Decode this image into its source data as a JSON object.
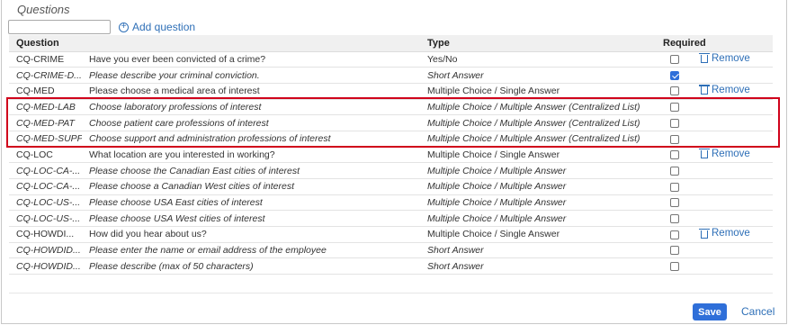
{
  "section_title": "Questions",
  "search": {
    "value": "",
    "placeholder": ""
  },
  "add_question_label": "Add question",
  "headers": {
    "question": "Question",
    "type": "Type",
    "required": "Required"
  },
  "rows": [
    {
      "code": "CQ-CRIME",
      "question": "Have you ever been convicted of a crime?",
      "type": "Yes/No",
      "required": false,
      "italic": false,
      "remove": "Remove"
    },
    {
      "code": "CQ-CRIME-D...",
      "question": "Please describe your criminal conviction.",
      "type": "Short Answer",
      "required": true,
      "italic": true,
      "remove": ""
    },
    {
      "code": "CQ-MED",
      "question": "Please choose a medical area of interest",
      "type": "Multiple Choice / Single Answer",
      "required": false,
      "italic": false,
      "remove": "Remove"
    },
    {
      "code": "CQ-MED-LAB",
      "question": "Choose laboratory professions of interest",
      "type": "Multiple Choice / Multiple Answer (Centralized List)",
      "required": false,
      "italic": true,
      "remove": ""
    },
    {
      "code": "CQ-MED-PAT",
      "question": "Choose patient care professions of interest",
      "type": "Multiple Choice / Multiple Answer (Centralized List)",
      "required": false,
      "italic": true,
      "remove": ""
    },
    {
      "code": "CQ-MED-SUPP",
      "question": "Choose support and administration professions of interest",
      "type": "Multiple Choice / Multiple Answer (Centralized List)",
      "required": false,
      "italic": true,
      "remove": ""
    },
    {
      "code": "CQ-LOC",
      "question": "What location are you interested in working?",
      "type": "Multiple Choice / Single Answer",
      "required": false,
      "italic": false,
      "remove": "Remove"
    },
    {
      "code": "CQ-LOC-CA-...",
      "question": "Please choose the Canadian East cities of interest",
      "type": "Multiple Choice / Multiple Answer",
      "required": false,
      "italic": true,
      "remove": ""
    },
    {
      "code": "CQ-LOC-CA-...",
      "question": "Please choose a Canadian West cities of interest",
      "type": "Multiple Choice / Multiple Answer",
      "required": false,
      "italic": true,
      "remove": ""
    },
    {
      "code": "CQ-LOC-US-...",
      "question": "Please choose USA East cities of interest",
      "type": "Multiple Choice / Multiple Answer",
      "required": false,
      "italic": true,
      "remove": ""
    },
    {
      "code": "CQ-LOC-US-...",
      "question": "Please choose USA West cities of interest",
      "type": "Multiple Choice / Multiple Answer",
      "required": false,
      "italic": true,
      "remove": ""
    },
    {
      "code": "CQ-HOWDI...",
      "question": "How did you hear about us?",
      "type": "Multiple Choice / Single Answer",
      "required": false,
      "italic": false,
      "remove": "Remove"
    },
    {
      "code": "CQ-HOWDID...",
      "question": "Please enter the name or email address of the employee",
      "type": "Short Answer",
      "required": false,
      "italic": true,
      "remove": ""
    },
    {
      "code": "CQ-HOWDID...",
      "question": "Please describe (max of 50 characters)",
      "type": "Short Answer",
      "required": false,
      "italic": true,
      "remove": ""
    }
  ],
  "save_label": "Save",
  "cancel_label": "Cancel",
  "colors": {
    "accent": "#2f6fd9",
    "link": "#2e6fb7",
    "highlight": "#d0021b"
  }
}
